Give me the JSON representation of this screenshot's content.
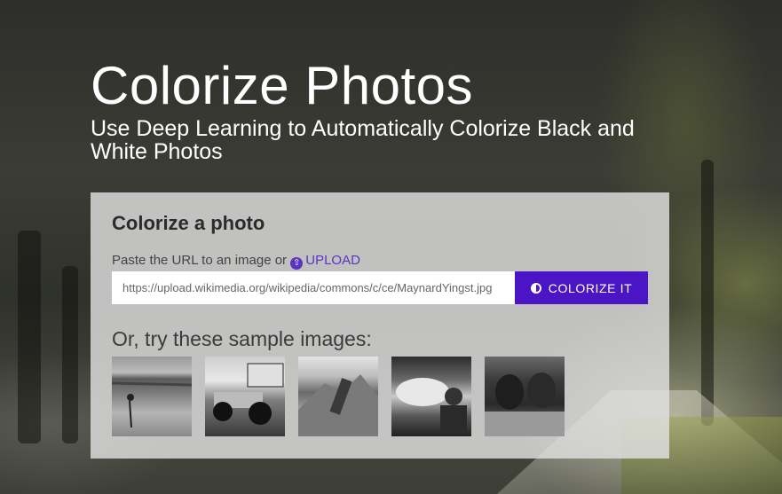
{
  "hero": {
    "title": "Colorize Photos",
    "subtitle": "Use Deep Learning to Automatically Colorize Black and White Photos"
  },
  "panel": {
    "heading": "Colorize a photo",
    "paste_prompt": "Paste the URL to an image or",
    "upload_label": "UPLOAD",
    "upload_icon": "upload-circle-icon",
    "url_value": "https://upload.wikimedia.org/wikipedia/commons/c/ce/MaynardYingst.jpg",
    "colorize_label": "COLORIZE IT",
    "colorize_icon": "half-circle-icon",
    "samples_title": "Or, try these sample images:",
    "samples": [
      {
        "subject": "bird-on-beach"
      },
      {
        "subject": "sprint-car-race"
      },
      {
        "subject": "mountain-climber"
      },
      {
        "subject": "fire-breather"
      },
      {
        "subject": "cows-in-field"
      }
    ]
  },
  "colors": {
    "accent": "#4b14c4",
    "link": "#5b34c2"
  }
}
